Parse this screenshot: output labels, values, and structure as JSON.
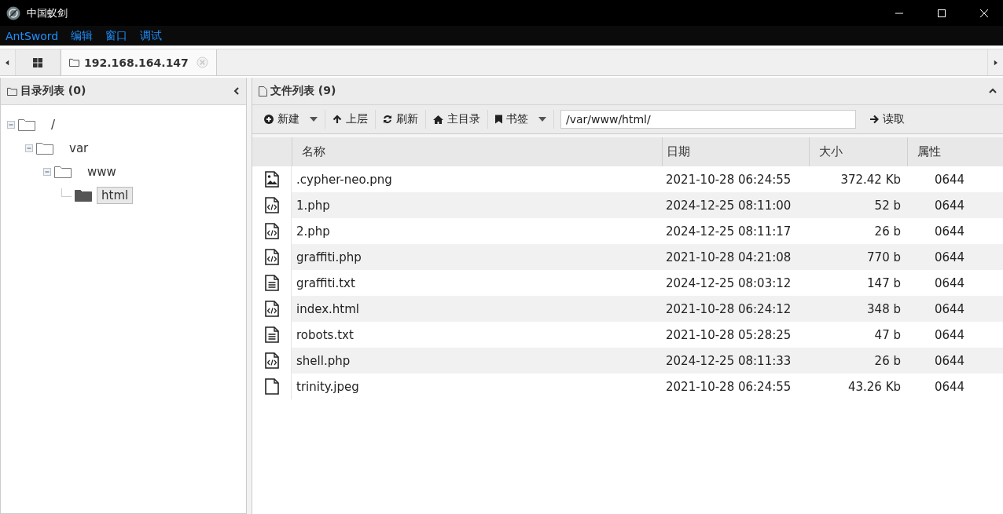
{
  "window": {
    "title": "中国蚁剑"
  },
  "menu": [
    "AntSword",
    "编辑",
    "窗口",
    "调试"
  ],
  "tabs": [
    {
      "kind": "grid",
      "selected": false
    },
    {
      "kind": "folder",
      "label": "192.168.164.147",
      "selected": true
    }
  ],
  "sidebar": {
    "title": "目录列表 (0)",
    "tree": [
      {
        "label": "/",
        "expanded": true,
        "selected": false,
        "children": [
          {
            "label": "var",
            "expanded": true,
            "selected": false,
            "children": [
              {
                "label": "www",
                "expanded": true,
                "selected": false,
                "children": [
                  {
                    "label": "html",
                    "selected": true
                  }
                ]
              }
            ]
          }
        ]
      }
    ]
  },
  "files_panel": {
    "title": "文件列表 (9)",
    "toolbar": [
      {
        "kind": "new",
        "label": "新建",
        "dropdown": true
      },
      {
        "kind": "up",
        "label": "上层",
        "dropdown": false
      },
      {
        "kind": "refresh",
        "label": "刷新",
        "dropdown": false
      },
      {
        "kind": "home",
        "label": "主目录",
        "dropdown": false
      },
      {
        "kind": "bookmark",
        "label": "书签",
        "dropdown": true
      }
    ],
    "path": "/var/www/html/",
    "read_button": "读取",
    "columns": [
      "名称",
      "日期",
      "大小",
      "属性"
    ],
    "rows": [
      {
        "kind": "image",
        "name": ".cypher-neo.png",
        "date": "2021-10-28 06:24:55",
        "size": "372.42 Kb",
        "perm": "0644"
      },
      {
        "kind": "code",
        "name": "1.php",
        "date": "2024-12-25 08:11:00",
        "size": "52 b",
        "perm": "0644"
      },
      {
        "kind": "code",
        "name": "2.php",
        "date": "2024-12-25 08:11:17",
        "size": "26 b",
        "perm": "0644"
      },
      {
        "kind": "code",
        "name": "graffiti.php",
        "date": "2021-10-28 04:21:08",
        "size": "770 b",
        "perm": "0644"
      },
      {
        "kind": "text",
        "name": "graffiti.txt",
        "date": "2024-12-25 08:03:12",
        "size": "147 b",
        "perm": "0644"
      },
      {
        "kind": "code",
        "name": "index.html",
        "date": "2021-10-28 06:24:12",
        "size": "348 b",
        "perm": "0644"
      },
      {
        "kind": "text",
        "name": "robots.txt",
        "date": "2021-10-28 05:28:25",
        "size": "47 b",
        "perm": "0644"
      },
      {
        "kind": "code",
        "name": "shell.php",
        "date": "2024-12-25 08:11:33",
        "size": "26 b",
        "perm": "0644"
      },
      {
        "kind": "file",
        "name": "trinity.jpeg",
        "date": "2021-10-28 06:24:55",
        "size": "43.26 Kb",
        "perm": "0644"
      }
    ]
  }
}
